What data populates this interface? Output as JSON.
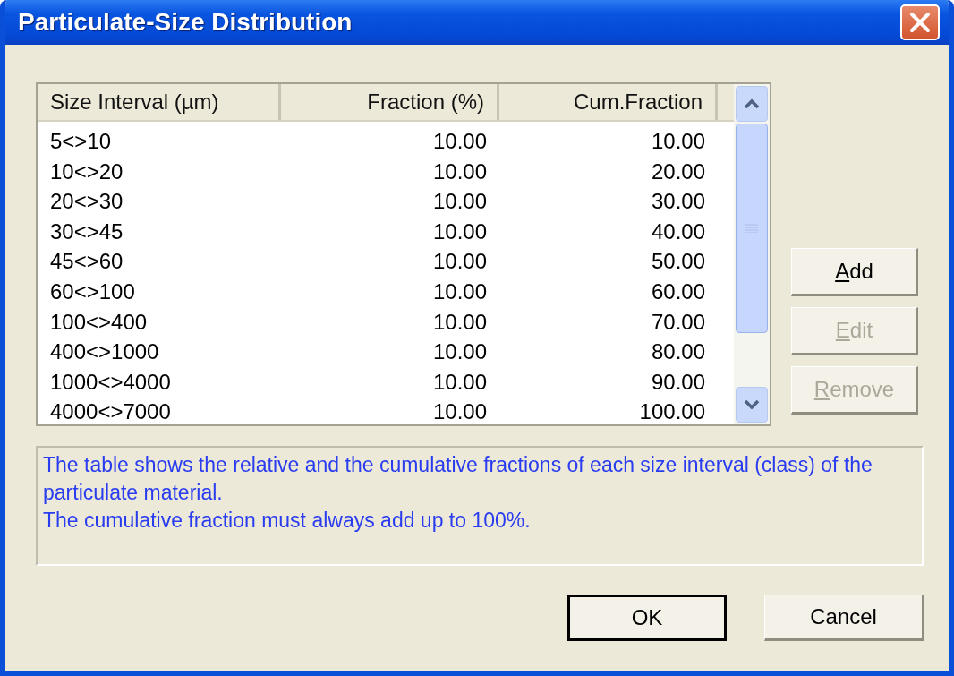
{
  "window": {
    "title": "Particulate-Size Distribution"
  },
  "table": {
    "columns": [
      "Size Interval (µm)",
      "Fraction (%)",
      "Cum.Fraction"
    ],
    "rows": [
      [
        "5<>10",
        "10.00",
        "10.00"
      ],
      [
        "10<>20",
        "10.00",
        "20.00"
      ],
      [
        "20<>30",
        "10.00",
        "30.00"
      ],
      [
        "30<>45",
        "10.00",
        "40.00"
      ],
      [
        "45<>60",
        "10.00",
        "50.00"
      ],
      [
        "60<>100",
        "10.00",
        "60.00"
      ],
      [
        "100<>400",
        "10.00",
        "70.00"
      ],
      [
        "400<>1000",
        "10.00",
        "80.00"
      ],
      [
        "1000<>4000",
        "10.00",
        "90.00"
      ],
      [
        "4000<>7000",
        "10.00",
        "100.00"
      ]
    ]
  },
  "side_buttons": [
    {
      "access_key": "A",
      "label_rest": "dd",
      "disabled": false
    },
    {
      "access_key": "E",
      "label_rest": "dit",
      "disabled": true
    },
    {
      "access_key": "R",
      "label_rest": "emove",
      "disabled": true
    }
  ],
  "info_text": [
    "The table shows the relative and the cumulative fractions of each size interval (class) of the particulate material.",
    "The cumulative fraction must always add up to 100%."
  ],
  "buttons": [
    {
      "label": "OK",
      "default": true
    },
    {
      "label": "Cancel",
      "default": false
    }
  ]
}
